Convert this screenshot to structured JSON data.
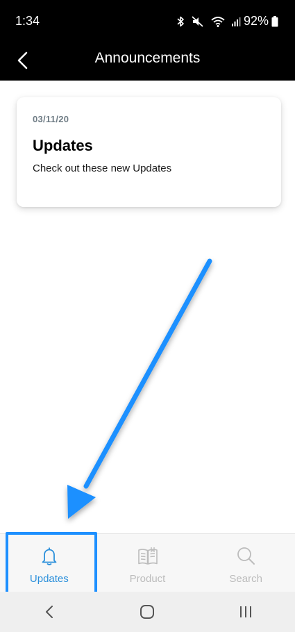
{
  "status_bar": {
    "time": "1:34",
    "battery_percent": "92%",
    "icons": [
      "bluetooth-icon",
      "mute-icon",
      "wifi-icon",
      "signal-icon",
      "battery-icon"
    ]
  },
  "app_bar": {
    "title": "Announcements",
    "back_icon": "chevron-left-icon"
  },
  "announcements": [
    {
      "date": "03/11/20",
      "title": "Updates",
      "body": "Check out these new Updates"
    }
  ],
  "tab_bar": {
    "tabs": [
      {
        "label": "Updates",
        "icon": "bell-icon",
        "active": true
      },
      {
        "label": "Product",
        "icon": "book-icon",
        "active": false
      },
      {
        "label": "Search",
        "icon": "search-icon",
        "active": false
      }
    ]
  },
  "nav_bar": {
    "buttons": [
      "back-icon",
      "home-icon",
      "recents-icon"
    ]
  },
  "colors": {
    "header_bg": "#000000",
    "accent": "#2a8fdb",
    "inactive": "#bcbcbc",
    "annotation": "#1e90ff"
  }
}
